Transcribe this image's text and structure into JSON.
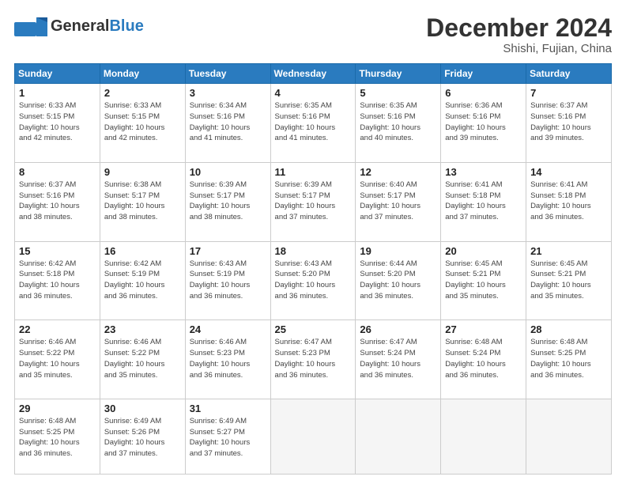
{
  "header": {
    "logo_general": "General",
    "logo_blue": "Blue",
    "month_title": "December 2024",
    "subtitle": "Shishi, Fujian, China"
  },
  "weekdays": [
    "Sunday",
    "Monday",
    "Tuesday",
    "Wednesday",
    "Thursday",
    "Friday",
    "Saturday"
  ],
  "weeks": [
    [
      {
        "day": "1",
        "info": "Sunrise: 6:33 AM\nSunset: 5:15 PM\nDaylight: 10 hours\nand 42 minutes."
      },
      {
        "day": "2",
        "info": "Sunrise: 6:33 AM\nSunset: 5:15 PM\nDaylight: 10 hours\nand 42 minutes."
      },
      {
        "day": "3",
        "info": "Sunrise: 6:34 AM\nSunset: 5:16 PM\nDaylight: 10 hours\nand 41 minutes."
      },
      {
        "day": "4",
        "info": "Sunrise: 6:35 AM\nSunset: 5:16 PM\nDaylight: 10 hours\nand 41 minutes."
      },
      {
        "day": "5",
        "info": "Sunrise: 6:35 AM\nSunset: 5:16 PM\nDaylight: 10 hours\nand 40 minutes."
      },
      {
        "day": "6",
        "info": "Sunrise: 6:36 AM\nSunset: 5:16 PM\nDaylight: 10 hours\nand 39 minutes."
      },
      {
        "day": "7",
        "info": "Sunrise: 6:37 AM\nSunset: 5:16 PM\nDaylight: 10 hours\nand 39 minutes."
      }
    ],
    [
      {
        "day": "8",
        "info": "Sunrise: 6:37 AM\nSunset: 5:16 PM\nDaylight: 10 hours\nand 38 minutes."
      },
      {
        "day": "9",
        "info": "Sunrise: 6:38 AM\nSunset: 5:17 PM\nDaylight: 10 hours\nand 38 minutes."
      },
      {
        "day": "10",
        "info": "Sunrise: 6:39 AM\nSunset: 5:17 PM\nDaylight: 10 hours\nand 38 minutes."
      },
      {
        "day": "11",
        "info": "Sunrise: 6:39 AM\nSunset: 5:17 PM\nDaylight: 10 hours\nand 37 minutes."
      },
      {
        "day": "12",
        "info": "Sunrise: 6:40 AM\nSunset: 5:17 PM\nDaylight: 10 hours\nand 37 minutes."
      },
      {
        "day": "13",
        "info": "Sunrise: 6:41 AM\nSunset: 5:18 PM\nDaylight: 10 hours\nand 37 minutes."
      },
      {
        "day": "14",
        "info": "Sunrise: 6:41 AM\nSunset: 5:18 PM\nDaylight: 10 hours\nand 36 minutes."
      }
    ],
    [
      {
        "day": "15",
        "info": "Sunrise: 6:42 AM\nSunset: 5:18 PM\nDaylight: 10 hours\nand 36 minutes."
      },
      {
        "day": "16",
        "info": "Sunrise: 6:42 AM\nSunset: 5:19 PM\nDaylight: 10 hours\nand 36 minutes."
      },
      {
        "day": "17",
        "info": "Sunrise: 6:43 AM\nSunset: 5:19 PM\nDaylight: 10 hours\nand 36 minutes."
      },
      {
        "day": "18",
        "info": "Sunrise: 6:43 AM\nSunset: 5:20 PM\nDaylight: 10 hours\nand 36 minutes."
      },
      {
        "day": "19",
        "info": "Sunrise: 6:44 AM\nSunset: 5:20 PM\nDaylight: 10 hours\nand 36 minutes."
      },
      {
        "day": "20",
        "info": "Sunrise: 6:45 AM\nSunset: 5:21 PM\nDaylight: 10 hours\nand 35 minutes."
      },
      {
        "day": "21",
        "info": "Sunrise: 6:45 AM\nSunset: 5:21 PM\nDaylight: 10 hours\nand 35 minutes."
      }
    ],
    [
      {
        "day": "22",
        "info": "Sunrise: 6:46 AM\nSunset: 5:22 PM\nDaylight: 10 hours\nand 35 minutes."
      },
      {
        "day": "23",
        "info": "Sunrise: 6:46 AM\nSunset: 5:22 PM\nDaylight: 10 hours\nand 35 minutes."
      },
      {
        "day": "24",
        "info": "Sunrise: 6:46 AM\nSunset: 5:23 PM\nDaylight: 10 hours\nand 36 minutes."
      },
      {
        "day": "25",
        "info": "Sunrise: 6:47 AM\nSunset: 5:23 PM\nDaylight: 10 hours\nand 36 minutes."
      },
      {
        "day": "26",
        "info": "Sunrise: 6:47 AM\nSunset: 5:24 PM\nDaylight: 10 hours\nand 36 minutes."
      },
      {
        "day": "27",
        "info": "Sunrise: 6:48 AM\nSunset: 5:24 PM\nDaylight: 10 hours\nand 36 minutes."
      },
      {
        "day": "28",
        "info": "Sunrise: 6:48 AM\nSunset: 5:25 PM\nDaylight: 10 hours\nand 36 minutes."
      }
    ],
    [
      {
        "day": "29",
        "info": "Sunrise: 6:48 AM\nSunset: 5:25 PM\nDaylight: 10 hours\nand 36 minutes."
      },
      {
        "day": "30",
        "info": "Sunrise: 6:49 AM\nSunset: 5:26 PM\nDaylight: 10 hours\nand 37 minutes."
      },
      {
        "day": "31",
        "info": "Sunrise: 6:49 AM\nSunset: 5:27 PM\nDaylight: 10 hours\nand 37 minutes."
      },
      null,
      null,
      null,
      null
    ]
  ]
}
